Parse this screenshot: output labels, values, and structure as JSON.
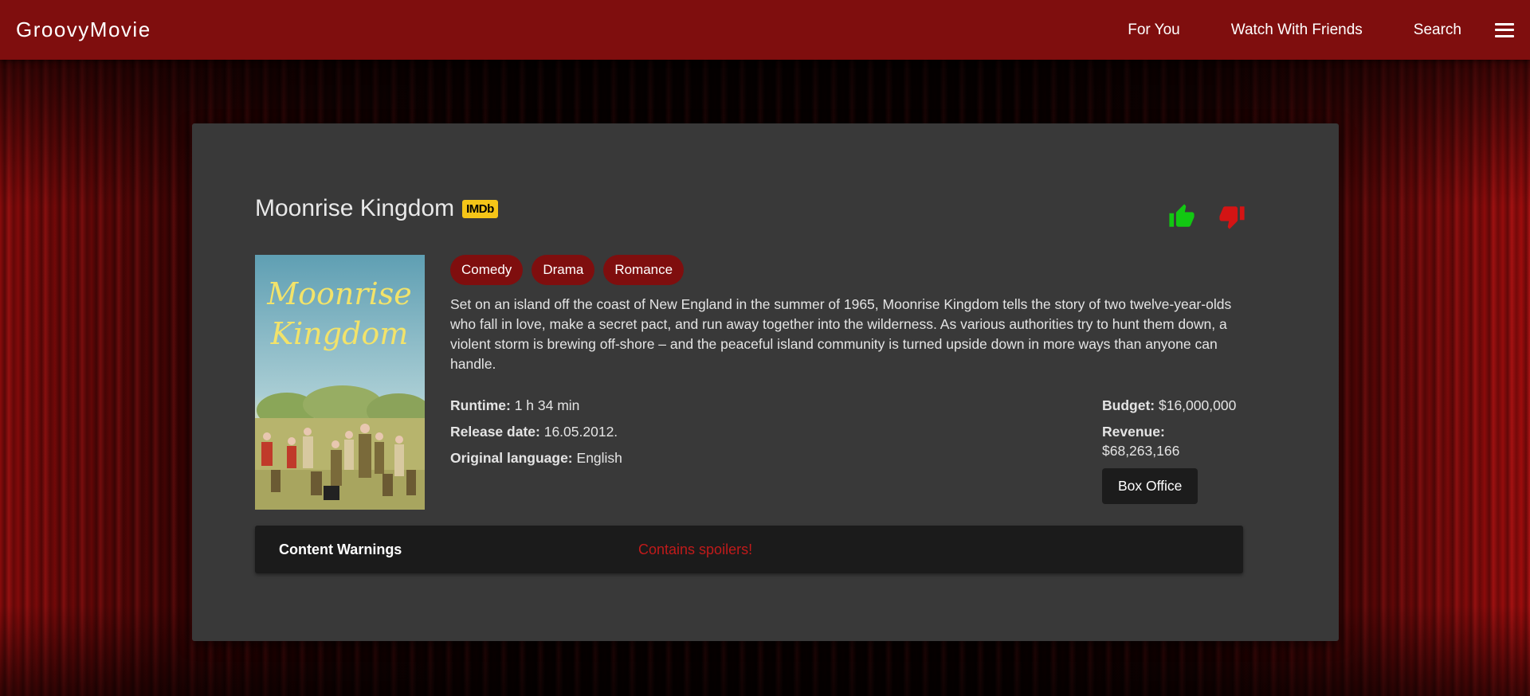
{
  "header": {
    "brand": "GroovyMovie",
    "nav": [
      {
        "label": "For You"
      },
      {
        "label": "Watch With Friends"
      },
      {
        "label": "Search"
      }
    ],
    "menu_icon": "hamburger-menu-icon"
  },
  "movie": {
    "title": "Moonrise Kingdom",
    "imdb_label": "IMDb",
    "poster_title_line1": "Moonrise",
    "poster_title_line2": "Kingdom",
    "genres": [
      "Comedy",
      "Drama",
      "Romance"
    ],
    "description": "Set on an island off the coast of New England in the summer of 1965, Moonrise Kingdom tells the story of two twelve-year-olds who fall in love, make a secret pact, and run away together into the wilderness. As various authorities try to hunt them down, a violent storm is brewing off-shore – and the peaceful island community is turned upside down in more ways than anyone can handle.",
    "facts_left": [
      {
        "label": "Runtime:",
        "value": "1 h 34 min"
      },
      {
        "label": "Release date:",
        "value": "16.05.2012."
      },
      {
        "label": "Original language:",
        "value": "English"
      }
    ],
    "facts_right": [
      {
        "label": "Budget:",
        "value": "$16,000,000"
      },
      {
        "label": "Revenue:",
        "value": "$68,263,166"
      }
    ],
    "box_office_label": "Box Office"
  },
  "votes": {
    "like_icon": "thumbs-up-icon",
    "dislike_icon": "thumbs-down-icon",
    "like_color": "#12c812",
    "dislike_color": "#d41414"
  },
  "warnings": {
    "label": "Content Warnings",
    "spoiler_text": "Contains spoilers!"
  },
  "colors": {
    "header_bg": "#7f0e0e",
    "card_bg": "#393939",
    "tag_bg": "#7f0e0e",
    "imdb_yellow": "#f5c518",
    "spoiler_red": "#c01b1b"
  }
}
